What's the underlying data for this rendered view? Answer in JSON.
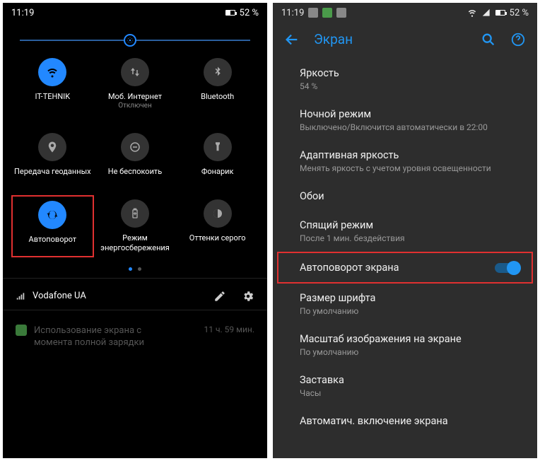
{
  "left": {
    "status": {
      "time": "11:19",
      "battery_pct": "52 %"
    },
    "tiles": [
      {
        "id": "wifi",
        "name": "wifi-icon",
        "label": "IT-TEHNIK",
        "sub": "",
        "on": true
      },
      {
        "id": "mobile-data",
        "name": "mobile-data-icon",
        "label": "Моб. Интернет",
        "sub": "Отключен",
        "on": false
      },
      {
        "id": "bluetooth",
        "name": "bluetooth-icon",
        "label": "Bluetooth",
        "sub": "",
        "on": false
      },
      {
        "id": "location",
        "name": "location-icon",
        "label": "Передача геоданных",
        "sub": "",
        "on": false
      },
      {
        "id": "dnd",
        "name": "dnd-icon",
        "label": "Не беспокоить",
        "sub": "",
        "on": false
      },
      {
        "id": "flashlight",
        "name": "flashlight-icon",
        "label": "Фонарик",
        "sub": "",
        "on": false
      },
      {
        "id": "autorotate",
        "name": "autorotate-icon",
        "label": "Автоповорот",
        "sub": "",
        "on": true,
        "highlight": true
      },
      {
        "id": "battery-saver",
        "name": "battery-saver-icon",
        "label": "Режим энергосбережения",
        "sub": "",
        "on": false
      },
      {
        "id": "grayscale",
        "name": "grayscale-icon",
        "label": "Оттенки серого",
        "sub": "",
        "on": false
      }
    ],
    "carrier": "Vodafone UA",
    "notif": {
      "title": "Использование экрана с",
      "sub": "момента полной зарядки",
      "time": "11 ч. 59 мин."
    }
  },
  "right": {
    "status": {
      "time": "11:19",
      "battery_pct": "52 %"
    },
    "appbar_title": "Экран",
    "items": [
      {
        "title": "Яркость",
        "sub": "54 %"
      },
      {
        "title": "Ночной режим",
        "sub": "Выключено/Включится автоматически в 22:00"
      },
      {
        "title": "Адаптивная яркость",
        "sub": "Менять яркость с учетом уровня освещенности"
      },
      {
        "title": "Обои",
        "sub": ""
      },
      {
        "title": "Спящий режим",
        "sub": "После 1 мин. бездействия"
      },
      {
        "title": "Автоповорот экрана",
        "sub": "",
        "toggle": true,
        "highlight": true
      },
      {
        "title": "Размер шрифта",
        "sub": "По умолчанию"
      },
      {
        "title": "Масштаб изображения на экране",
        "sub": "По умолчанию"
      },
      {
        "title": "Заставка",
        "sub": "Часы"
      },
      {
        "title": "Автоматич. включение экрана",
        "sub": ""
      }
    ]
  }
}
